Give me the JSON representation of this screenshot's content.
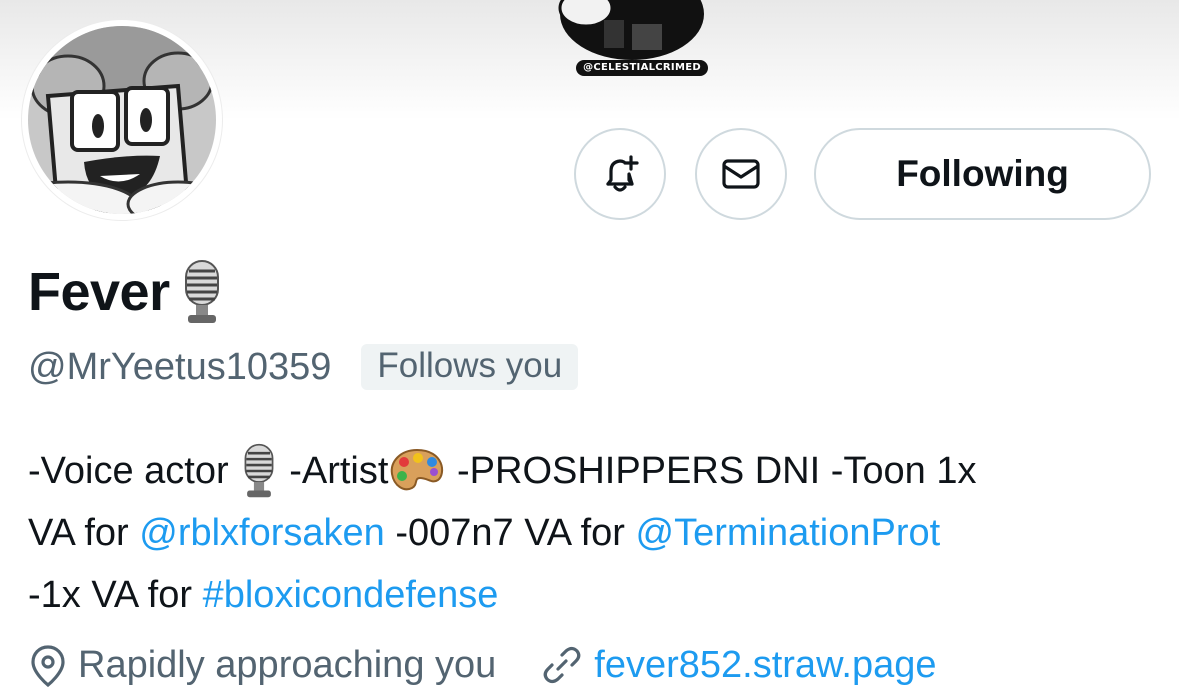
{
  "banner": {
    "credit": "@CELESTIALCRIMED"
  },
  "profile": {
    "display_name": "Fever",
    "handle": "@MrYeetus10359",
    "follows_badge": "Follows you",
    "name_emoji": "microphone-icon"
  },
  "actions": {
    "notify_icon": "bell-plus-icon",
    "message_icon": "envelope-icon",
    "following_label": "Following"
  },
  "bio": {
    "line1_a": "-Voice actor",
    "line1_b": " -Artist",
    "line1_c": " -PROSHIPPERS DNI -Toon 1x",
    "line2_a": "VA for ",
    "line2_mention1": "@rblxforsaken",
    "line2_b": " -007n7 VA for ",
    "line2_mention2": "@TerminationProt",
    "line3_a": "-1x VA for ",
    "line3_hashtag": "#bloxicondefense"
  },
  "meta": {
    "location": "Rapidly approaching you",
    "link": "fever852.straw.page"
  },
  "colors": {
    "link": "#1d9bf0",
    "secondary_text": "#536471",
    "border": "#cfd9de",
    "primary_text": "#0f1419"
  }
}
